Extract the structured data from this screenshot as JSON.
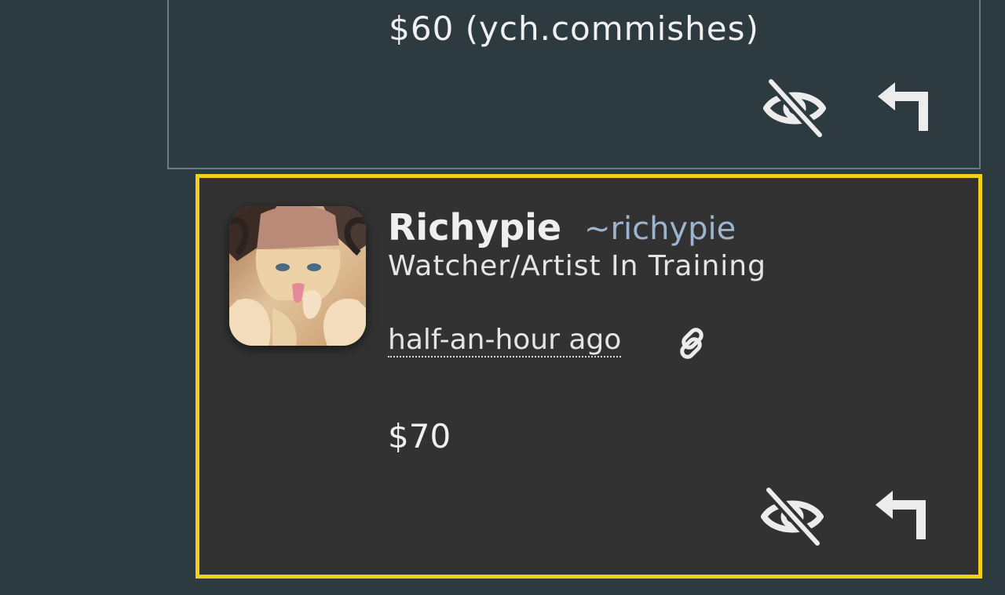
{
  "previous_comment": {
    "text": "$60 (ych.commishes)",
    "actions": {
      "hide_icon": "eye-slash-icon",
      "reply_icon": "reply-arrow-icon"
    }
  },
  "comment": {
    "display_name": "Richypie",
    "username": "~richypie",
    "user_title": "Watcher/Artist In Training",
    "timestamp": "half-an-hour ago",
    "link_icon": "link-icon",
    "text": "$70",
    "actions": {
      "hide_icon": "eye-slash-icon",
      "reply_icon": "reply-arrow-icon"
    }
  },
  "colors": {
    "page_background": "#2d3a40",
    "comment_background": "#323232",
    "highlight_border": "#f2cf1a",
    "username": "#9db4cf",
    "text": "#efefef"
  }
}
